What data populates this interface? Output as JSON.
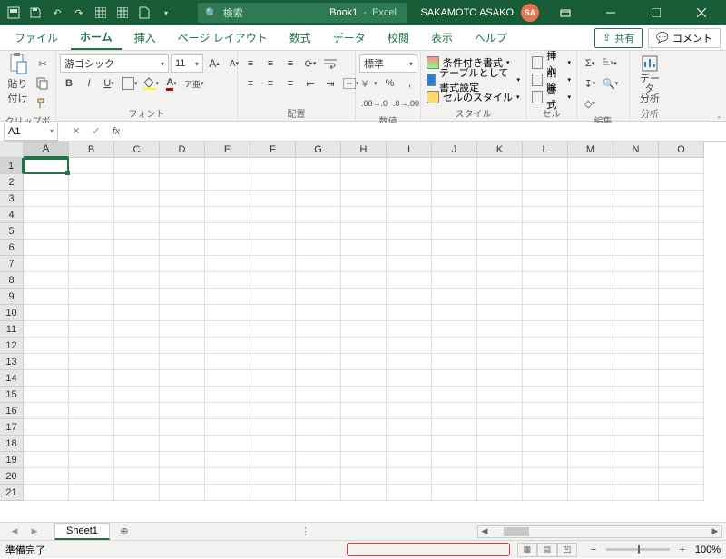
{
  "title": {
    "doc": "Book1",
    "app": "Excel",
    "sep": "-"
  },
  "search": {
    "placeholder": "検索"
  },
  "account": {
    "name": "SAKAMOTO ASAKO",
    "initials": "SA"
  },
  "tabs": {
    "items": [
      "ファイル",
      "ホーム",
      "挿入",
      "ページ レイアウト",
      "数式",
      "データ",
      "校閲",
      "表示",
      "ヘルプ"
    ],
    "active": 1,
    "share": "共有",
    "comment": "コメント"
  },
  "ribbon": {
    "clipboard": {
      "label": "クリップボード",
      "paste": "貼り付け"
    },
    "font": {
      "label": "フォント",
      "name": "游ゴシック",
      "size": "11",
      "bold": "B",
      "italic": "I",
      "underline": "U"
    },
    "alignment": {
      "label": "配置"
    },
    "number": {
      "label": "数値",
      "format": "標準"
    },
    "styles": {
      "label": "スタイル",
      "conditional": "条件付き書式",
      "table": "テーブルとして書式設定",
      "cell": "セルのスタイル"
    },
    "cells": {
      "label": "セル",
      "insert": "挿入",
      "delete": "削除",
      "format": "書式"
    },
    "editing": {
      "label": "編集"
    },
    "analysis": {
      "label": "分析",
      "btn": "データ\n分析"
    }
  },
  "formula": {
    "namebox": "A1"
  },
  "grid": {
    "cols": [
      "A",
      "B",
      "C",
      "D",
      "E",
      "F",
      "G",
      "H",
      "I",
      "J",
      "K",
      "L",
      "M",
      "N",
      "O"
    ],
    "rows": 21,
    "active": {
      "row": 1,
      "col": "A"
    }
  },
  "sheets": {
    "tab": "Sheet1"
  },
  "status": {
    "ready": "準備完了",
    "zoom": "100%"
  }
}
